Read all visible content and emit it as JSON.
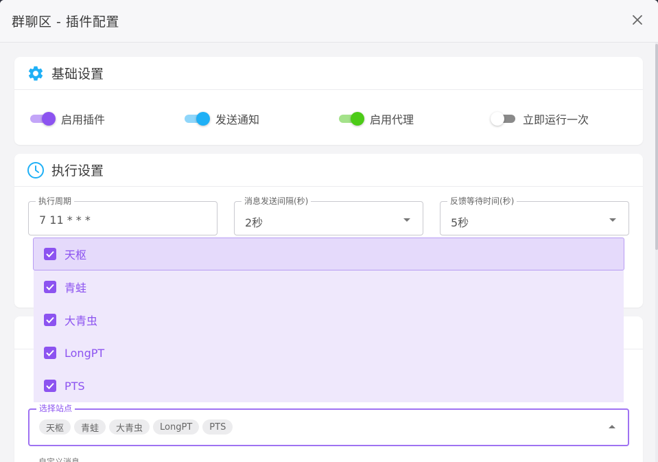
{
  "dialog": {
    "title": "群聊区 - 插件配置"
  },
  "basic": {
    "title": "基础设置",
    "switches": [
      {
        "label": "启用插件",
        "on": true,
        "color": "#8c53f0"
      },
      {
        "label": "发送通知",
        "on": true,
        "color": "#1fb0f6"
      },
      {
        "label": "启用代理",
        "on": true,
        "color": "#4ccb17"
      },
      {
        "label": "立即运行一次",
        "on": false,
        "color": "#8a8a8a"
      }
    ]
  },
  "exec": {
    "title": "执行设置",
    "fields": [
      {
        "label": "执行周期",
        "value": "7 11 * * *"
      },
      {
        "label": "消息发送间隔(秒)",
        "value": "2秒"
      },
      {
        "label": "反馈等待时间(秒)",
        "value": "5秒"
      }
    ]
  },
  "dropdown": {
    "items": [
      "天枢",
      "青蛙",
      "大青虫",
      "LongPT",
      "PTS"
    ]
  },
  "sites": {
    "label": "选择站点",
    "chips": [
      "天枢",
      "青蛙",
      "大青虫",
      "LongPT",
      "PTS"
    ]
  },
  "custom": {
    "label": "自定义消息"
  },
  "colors": {
    "accent": "#8c53f0",
    "blue": "#1fb0f6",
    "green": "#4ccb17"
  }
}
